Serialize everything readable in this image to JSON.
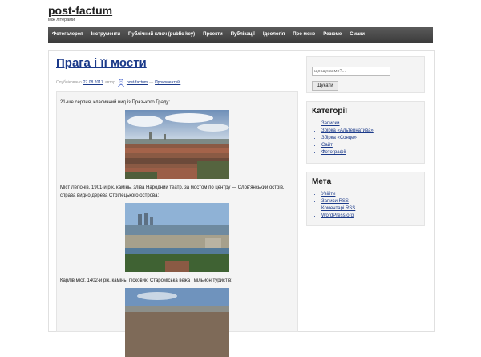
{
  "site": {
    "title": "post-factum",
    "description": "між літерами"
  },
  "nav": {
    "items": [
      "Фотогалерея",
      "Інструменти",
      "Публічний ключ (public key)",
      "Проекти",
      "Публікації",
      "Ідеологія",
      "Про мене",
      "Резюме",
      "Смаки"
    ]
  },
  "post": {
    "title": "Прага і її мости",
    "meta_published": "Опубліковано",
    "meta_date": "27.08.2017",
    "meta_author_prefix": "автор",
    "meta_author": "post-factum",
    "meta_sep": "—",
    "meta_comment": "Прокоментуй!",
    "paragraphs": [
      "21-ше серпня, класичний вид із Празького Граду:",
      "Міст Легіонів, 1901-й рік, камінь, зліва Народний театр, за мостом по центру — Слов'янський острів, справа видно дерева Стрілецького острова:",
      "Карлів міст, 1402-й рік, камінь, пісковик, Староміська вежа і мільйон туристів:"
    ]
  },
  "search": {
    "placeholder": "що шукаємо?...",
    "button": "Шукати"
  },
  "categories": {
    "title": "Категорії",
    "items": [
      "Записки",
      "Збірка «Альтернатива»",
      "Збірка «Сонце»",
      "Сайт",
      "Фотографії"
    ]
  },
  "meta_widget": {
    "title": "Мета",
    "items": [
      "Увійти",
      "Записи RSS",
      "Коментарі RSS",
      "WordPress.org"
    ]
  },
  "colors": {
    "link": "#1b3a8a",
    "nav_bg": "#4a4a4a"
  }
}
